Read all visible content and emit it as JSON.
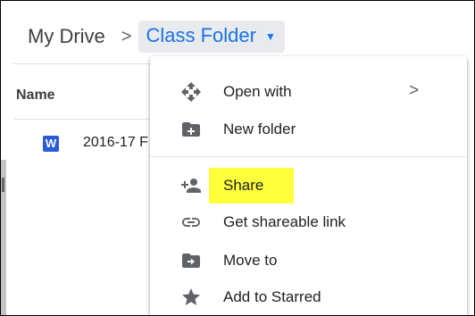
{
  "breadcrumb": {
    "root": "My Drive",
    "separator": ">",
    "current": "Class Folder",
    "caret": "▼"
  },
  "file_list": {
    "column_name": "Name",
    "files": [
      {
        "icon_text": "W",
        "icon_name": "word-doc-icon",
        "name": "2016-17 F"
      }
    ]
  },
  "context_menu": {
    "items": [
      {
        "label": "Open with",
        "icon": "open-with-move-icon",
        "has_submenu": true,
        "submenu_indicator": ">"
      },
      {
        "label": "New folder",
        "icon": "new-folder-icon"
      },
      {
        "label": "Share",
        "icon": "person-add-icon",
        "highlighted": true
      },
      {
        "label": "Get shareable link",
        "icon": "link-icon"
      },
      {
        "label": "Move to",
        "icon": "move-to-folder-icon"
      },
      {
        "label": "Add to Starred",
        "icon": "star-icon"
      }
    ],
    "highlight_color": "#ffff3b"
  },
  "colors": {
    "accent": "#1a73e8",
    "breadcrumb_chip": "#e8eaed",
    "icon_gray": "#5f6368",
    "word_blue": "#2a5bd7"
  }
}
